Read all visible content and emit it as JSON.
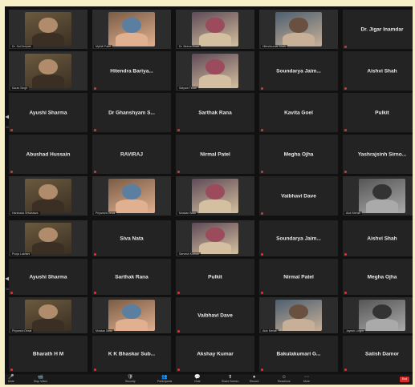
{
  "screen1": {
    "tiles": [
      {
        "type": "video",
        "caption": "Dr. Sai Deepak"
      },
      {
        "type": "video",
        "caption": "Mythili Patel"
      },
      {
        "type": "video",
        "caption": "Dr. Beena Bhatt"
      },
      {
        "type": "video",
        "caption": "Hiteshkumar Shah"
      },
      {
        "type": "name",
        "name": "Dr. Jigar Inamdar"
      },
      {
        "type": "video",
        "caption": "Karan Singh"
      },
      {
        "type": "name",
        "name": "Hitendra Bariya..."
      },
      {
        "type": "video",
        "caption": "Satyam Tiwari"
      },
      {
        "type": "name",
        "name": "Soundarya Jaim..."
      },
      {
        "type": "name",
        "name": "Aishvi Shah"
      },
      {
        "type": "name",
        "name": "Ayushi Sharma"
      },
      {
        "type": "name",
        "name": "Dr Ghanshyam S..."
      },
      {
        "type": "name",
        "name": "Sarthak Rana"
      },
      {
        "type": "name",
        "name": "Kavita Goel"
      },
      {
        "type": "name",
        "name": "Pulkit"
      },
      {
        "type": "name",
        "name": "Abushad Hussain"
      },
      {
        "type": "name",
        "name": "RAVIRAJ"
      },
      {
        "type": "name",
        "name": "Nirmal Patel"
      },
      {
        "type": "name",
        "name": "Megha Ojha"
      },
      {
        "type": "name",
        "name": "Yashrajsinh Sirno..."
      },
      {
        "type": "video",
        "caption": "Harshada Srivastava"
      },
      {
        "type": "video",
        "caption": "Priyanshi Desai"
      },
      {
        "type": "video",
        "caption": "Muskan Basu"
      },
      {
        "type": "name",
        "name": "Vaibhavi Dave"
      },
      {
        "type": "video",
        "caption": "Alok Mehta"
      }
    ]
  },
  "screen2": {
    "tiles": [
      {
        "type": "video",
        "caption": "Pooja Lakhani"
      },
      {
        "type": "name",
        "name": "Siva Nata"
      },
      {
        "type": "video",
        "caption": "Sarvesh Kothari"
      },
      {
        "type": "name",
        "name": "Soundarya Jaim..."
      },
      {
        "type": "name",
        "name": "Aishvi Shah"
      },
      {
        "type": "name",
        "name": "Ayushi Sharma"
      },
      {
        "type": "name",
        "name": "Sarthak Rana"
      },
      {
        "type": "name",
        "name": "Pulkit"
      },
      {
        "type": "name",
        "name": "Nirmal Patel"
      },
      {
        "type": "name",
        "name": "Megha Ojha"
      },
      {
        "type": "video",
        "caption": "Priyanshi Desai"
      },
      {
        "type": "video",
        "caption": "Muskan Basu"
      },
      {
        "type": "name",
        "name": "Vaibhavi Dave"
      },
      {
        "type": "video",
        "caption": "Alok Mehta"
      },
      {
        "type": "video",
        "caption": "Jayesh Lingra"
      },
      {
        "type": "name",
        "name": "Bharath H M"
      },
      {
        "type": "name",
        "name": "K K Bhaskar Sub..."
      },
      {
        "type": "name",
        "name": "Akshay Kumar"
      },
      {
        "type": "name",
        "name": "Bakulakumari G..."
      },
      {
        "type": "name",
        "name": "Satish Damor"
      }
    ]
  },
  "toolbar": {
    "items": [
      {
        "icon": "🎤",
        "label": "Mute"
      },
      {
        "icon": "📹",
        "label": "Stop Video"
      },
      {
        "icon": "🛡",
        "label": "Security"
      },
      {
        "icon": "👥",
        "label": "Participants"
      },
      {
        "icon": "💬",
        "label": "Chat"
      },
      {
        "icon": "⬆",
        "label": "Share Screen"
      },
      {
        "icon": "⏺",
        "label": "Record"
      },
      {
        "icon": "☺",
        "label": "Reactions"
      },
      {
        "icon": "⋯",
        "label": "More"
      }
    ],
    "end_label": "End"
  },
  "pagination": {
    "screen1": "1/4",
    "screen2": "1/4"
  }
}
